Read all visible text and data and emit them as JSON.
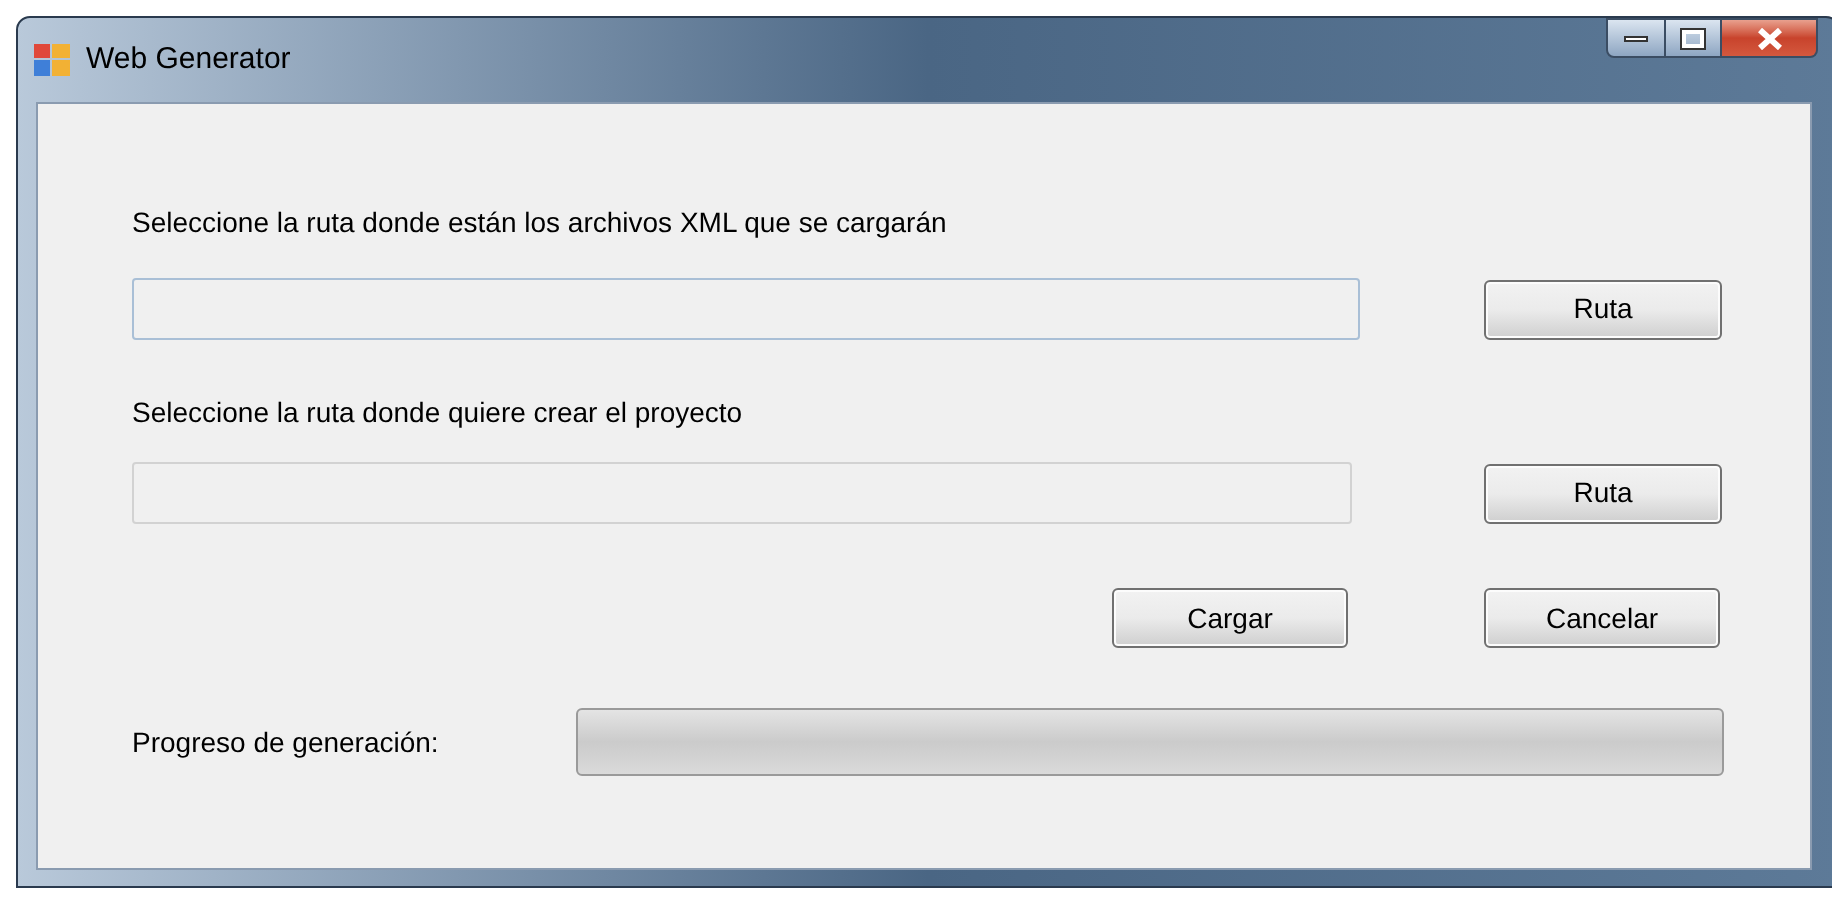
{
  "window": {
    "title": "Web Generator"
  },
  "xml_path": {
    "label": "Seleccione la ruta donde están los archivos XML que se cargarán",
    "button": "Ruta"
  },
  "project_path": {
    "label": "Seleccione la ruta donde quiere crear el proyecto",
    "button": "Ruta"
  },
  "buttons": [
    "Cargar",
    "Cancelar"
  ],
  "progress": {
    "label": "Progreso de generación:",
    "level": 0
  }
}
